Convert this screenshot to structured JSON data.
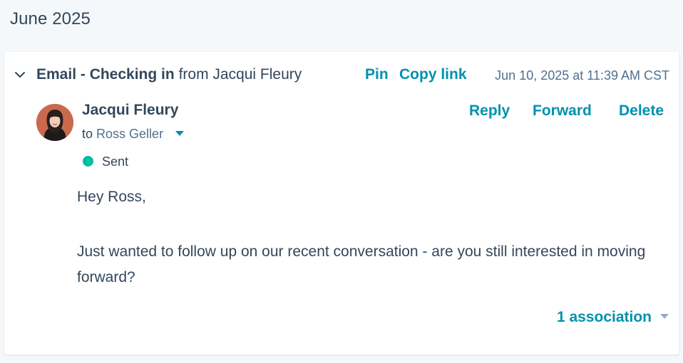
{
  "timeline": {
    "month_heading": "June 2025"
  },
  "activity": {
    "type_label": "Email - Checking in",
    "from_label": "from Jacqui Fleury",
    "pin_label": "Pin",
    "copy_link_label": "Copy link",
    "timestamp": "Jun 10, 2025 at 11:39 AM CST",
    "sender": {
      "name": "Jacqui Fleury",
      "to_prefix": "to",
      "recipient": "Ross Geller"
    },
    "actions": {
      "reply": "Reply",
      "forward": "Forward",
      "delete": "Delete"
    },
    "status": {
      "label": "Sent",
      "color": "#00bda5"
    },
    "body": {
      "greeting": "Hey Ross,",
      "message": "Just wanted to follow up on our recent conversation - are you still interested in moving forward?"
    },
    "associations_label": "1 association"
  },
  "colors": {
    "link": "#0091ae",
    "text": "#33475b",
    "muted": "#516f90",
    "page_bg": "#f5f8fa"
  },
  "icons": {
    "collapse": "chevron-down-icon",
    "recipient_dropdown": "caret-down-icon",
    "associations_dropdown": "caret-down-icon"
  }
}
